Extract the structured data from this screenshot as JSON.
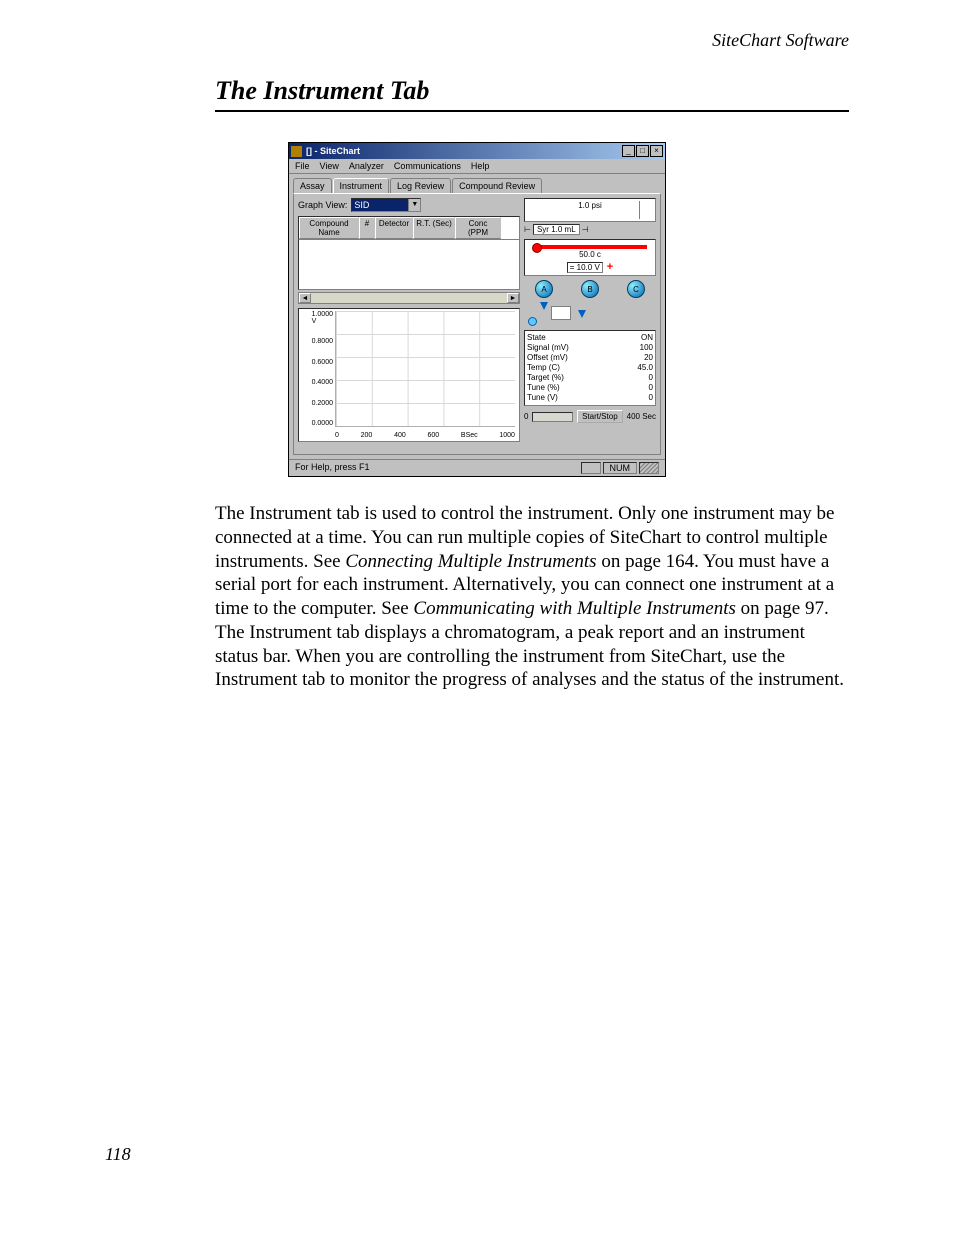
{
  "doc": {
    "running_header": "SiteChart Software",
    "section_title": "The Instrument Tab",
    "page_number": "118",
    "body_parts": {
      "p1a": "The Instrument tab is used to control the instrument. Only one instrument may be connected at a time. You can run multiple copies of SiteChart to control multiple instruments. See ",
      "p1_link1": "Connecting Multiple Instruments",
      "p1b": " on page 164. You must have a serial port for each instrument. Alternatively, you can connect one instrument at a time to the computer. See ",
      "p1_link2": "Communicating with Multiple Instruments",
      "p1c": " on page 97. The Instrument tab displays a chromatogram, a peak report and an instrument status bar. When you are controlling the instrument from SiteChart, use the Instrument tab to monitor the progress of analyses and the status of the instrument."
    }
  },
  "app": {
    "title": "[] - SiteChart",
    "menus": {
      "file": "File",
      "view": "View",
      "analyzer": "Analyzer",
      "comm": "Communications",
      "help": "Help"
    },
    "tabs": {
      "assay": "Assay",
      "instrument": "Instrument",
      "logreview": "Log Review",
      "compound": "Compound Review"
    },
    "graphview_label": "Graph View:",
    "graphview_value": "SID",
    "table_headers": {
      "name": "Compound Name",
      "num": "#",
      "det": "Detector",
      "rt": "R.T. (Sec)",
      "conc": "Conc (PPM"
    },
    "statusbar_help": "For Help, press F1",
    "statusbar_num": "NUM"
  },
  "instrument": {
    "psi": "1.0 psi",
    "syr": "Syr 1.0 mL",
    "temp_top": "50.0 c",
    "volt_val": "= 10.0 V",
    "abc": {
      "a": "A",
      "b": "B",
      "c": "C"
    },
    "readout": {
      "state_l": "State",
      "state_v": "ON",
      "signal_l": "Signal (mV)",
      "signal_v": "100",
      "offset_l": "Offset (mV)",
      "offset_v": "20",
      "temp_l": "Temp (C)",
      "temp_v": "45.0",
      "target_l": "Target (%)",
      "target_v": "0",
      "tune1_l": "Tune (%)",
      "tune1_v": "0",
      "tune2_l": "Tune (V)",
      "tune2_v": "0"
    },
    "zero": "0",
    "startstop": "Start/Stop",
    "sec": "400 Sec"
  },
  "chart_data": {
    "type": "line",
    "title": "",
    "xlabel": "BSec",
    "ylabel": "V",
    "x_ticks": [
      "0",
      "200",
      "400",
      "600",
      "BSec",
      "1000"
    ],
    "y_ticks": [
      "1.0000",
      "0.8000",
      "0.6000",
      "0.4000",
      "0.2000",
      "0.0000"
    ],
    "xlim": [
      0,
      1000
    ],
    "ylim": [
      0.0,
      1.0
    ],
    "series": []
  }
}
